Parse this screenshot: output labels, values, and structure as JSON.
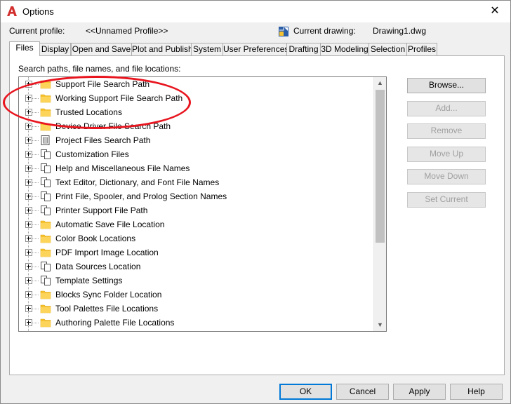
{
  "window": {
    "title": "Options",
    "close_glyph": "✕"
  },
  "profile": {
    "current_profile_label": "Current profile:",
    "current_profile_value": "<<Unnamed Profile>>",
    "current_drawing_label": "Current drawing:",
    "current_drawing_value": "Drawing1.dwg"
  },
  "tabs": [
    {
      "label": "Files",
      "active": true
    },
    {
      "label": "Display"
    },
    {
      "label": "Open and Save"
    },
    {
      "label": "Plot and Publish"
    },
    {
      "label": "System"
    },
    {
      "label": "User Preferences"
    },
    {
      "label": "Drafting"
    },
    {
      "label": "3D Modeling"
    },
    {
      "label": "Selection"
    },
    {
      "label": "Profiles"
    }
  ],
  "files": {
    "section_label": "Search paths, file names, and file locations:",
    "tree_items": [
      {
        "label": "Support File Search Path",
        "icon": "folder-icon"
      },
      {
        "label": "Working Support File Search Path",
        "icon": "folder-icon"
      },
      {
        "label": "Trusted Locations",
        "icon": "folder-icon"
      },
      {
        "label": "Device Driver File Search Path",
        "icon": "folder-icon"
      },
      {
        "label": "Project Files Search Path",
        "icon": "project-icon"
      },
      {
        "label": "Customization Files",
        "icon": "files-icon"
      },
      {
        "label": "Help and Miscellaneous File Names",
        "icon": "files-icon"
      },
      {
        "label": "Text Editor, Dictionary, and Font File Names",
        "icon": "files-icon"
      },
      {
        "label": "Print File, Spooler, and Prolog Section Names",
        "icon": "files-icon"
      },
      {
        "label": "Printer Support File Path",
        "icon": "files-icon"
      },
      {
        "label": "Automatic Save File Location",
        "icon": "folder-icon"
      },
      {
        "label": "Color Book Locations",
        "icon": "folder-icon"
      },
      {
        "label": "PDF Import Image Location",
        "icon": "folder-icon"
      },
      {
        "label": "Data Sources Location",
        "icon": "files-icon"
      },
      {
        "label": "Template Settings",
        "icon": "files-icon"
      },
      {
        "label": "Blocks Sync Folder Location",
        "icon": "folder-icon"
      },
      {
        "label": "Tool Palettes File Locations",
        "icon": "folder-icon"
      },
      {
        "label": "Authoring Palette File Locations",
        "icon": "folder-icon"
      }
    ],
    "buttons": {
      "browse": "Browse...",
      "add": "Add...",
      "remove": "Remove",
      "move_up": "Move Up",
      "move_down": "Move Down",
      "set_current": "Set Current"
    }
  },
  "footer": {
    "ok": "OK",
    "cancel": "Cancel",
    "apply": "Apply",
    "help": "Help"
  },
  "colors": {
    "folder": "#f7c22f",
    "annotation": "#e8151f",
    "accent": "#0078d7",
    "brand": "#d32f2f"
  }
}
